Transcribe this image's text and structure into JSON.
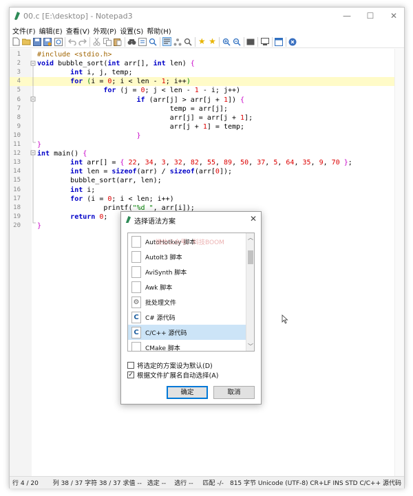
{
  "window": {
    "title": "00.c [E:\\desktop] - Notepad3",
    "controls": {
      "minimize": "—",
      "maximize": "☐",
      "close": "✕"
    }
  },
  "menu": [
    "文件(F)",
    "编辑(E)",
    "查看(V)",
    "外观(P)",
    "设置(S)",
    "帮助(H)"
  ],
  "toolbar": {
    "icons": [
      "new-file-icon",
      "open-folder-icon",
      "save-icon",
      "save-as-icon",
      "browse-icon",
      "undo-icon",
      "redo-icon",
      "cut-icon",
      "copy-icon",
      "paste-icon",
      "find-icon",
      "replace-icon",
      "goto-icon",
      "wordwrap-icon",
      "favorites-icon",
      "add-favorite-icon",
      "zoom-in-icon",
      "zoom-out-icon",
      "scheme-icon",
      "customize-icon",
      "open-window-icon",
      "settings-icon",
      "exit-icon"
    ]
  },
  "editor": {
    "active_line": 4,
    "lines": [
      {
        "n": "1",
        "html": "<span class=\"pp\">#include</span> <span class=\"pp\">&lt;stdio.h&gt;</span>"
      },
      {
        "n": "2",
        "html": "<span class=\"kw\">void</span> bubble_sort(<span class=\"kw\">int</span> arr[], <span class=\"kw\">int</span> len) <span class=\"brace\">{</span>"
      },
      {
        "n": "3",
        "html": "        <span class=\"kw\">int</span> i, j, temp;"
      },
      {
        "n": "4",
        "html": "        <span class=\"kw\">for</span> <span class=\"str\">(</span>i = <span class=\"num\">0</span>; i &lt; len - <span class=\"num\">1</span>; i++<span class=\"str\">)</span>"
      },
      {
        "n": "5",
        "html": "                <span class=\"kw\">for</span> (j = <span class=\"num\">0</span>; j &lt; len - <span class=\"num\">1</span> - i; j++)"
      },
      {
        "n": "6",
        "html": "                        <span class=\"kw\">if</span> (arr[j] &gt; arr[j + <span class=\"num\">1</span>]) <span class=\"brace\">{</span>"
      },
      {
        "n": "7",
        "html": "                                temp = arr[j];"
      },
      {
        "n": "8",
        "html": "                                arr[j] = arr[j + <span class=\"num\">1</span>];"
      },
      {
        "n": "9",
        "html": "                                arr[j + <span class=\"num\">1</span>] = temp;"
      },
      {
        "n": "10",
        "html": "                        <span class=\"brace\">}</span>"
      },
      {
        "n": "11",
        "html": "<span class=\"brace\">}</span>"
      },
      {
        "n": "12",
        "html": "<span class=\"kw\">int</span> main() <span class=\"brace\">{</span>"
      },
      {
        "n": "13",
        "html": "        <span class=\"kw\">int</span> arr[] = <span class=\"brace\">{</span> <span class=\"num\">22</span>, <span class=\"num\">34</span>, <span class=\"num\">3</span>, <span class=\"num\">32</span>, <span class=\"num\">82</span>, <span class=\"num\">55</span>, <span class=\"num\">89</span>, <span class=\"num\">50</span>, <span class=\"num\">37</span>, <span class=\"num\">5</span>, <span class=\"num\">64</span>, <span class=\"num\">35</span>, <span class=\"num\">9</span>, <span class=\"num\">70</span> <span class=\"brace\">}</span>;"
      },
      {
        "n": "14",
        "html": "        <span class=\"kw\">int</span> len = <span class=\"kw\">sizeof</span>(arr) / <span class=\"kw\">sizeof</span>(arr[<span class=\"num\">0</span>]);"
      },
      {
        "n": "15",
        "html": "        bubble_sort(arr, len);"
      },
      {
        "n": "16",
        "html": "        <span class=\"kw\">int</span> i;"
      },
      {
        "n": "17",
        "html": "        <span class=\"kw\">for</span> (i = <span class=\"num\">0</span>; i &lt; len; i++)"
      },
      {
        "n": "18",
        "html": "                printf(<span class=\"str\">\"%d \"</span>, arr[i]);"
      },
      {
        "n": "19",
        "html": "        <span class=\"kw\">return</span> <span class=\"num\">0</span>;"
      },
      {
        "n": "20",
        "html": "<span class=\"brace\">}</span>"
      }
    ]
  },
  "statusbar": {
    "line": "行 4 / 20",
    "col": "列 38 / 37 字符 38 / 37 求值 --",
    "sel": "选定 --",
    "sel_lines": "选行 --",
    "match": "匹配 -/-",
    "size": "815 字节 Unicode (UTF-8) CR+LF INS STD C/C++ 源代码"
  },
  "dialog": {
    "title": "选择语法方案",
    "watermark": "微信公众号：科技BOOM",
    "items": [
      {
        "label": "AutoHotkey 脚本",
        "icon": "file-icon",
        "selected": false
      },
      {
        "label": "AutoIt3 脚本",
        "icon": "file-icon",
        "selected": false
      },
      {
        "label": "AviSynth 脚本",
        "icon": "file-icon",
        "selected": false
      },
      {
        "label": "Awk 脚本",
        "icon": "file-icon",
        "selected": false
      },
      {
        "label": "批处理文件",
        "icon": "batch-gear-icon",
        "selected": false
      },
      {
        "label": "C# 源代码",
        "icon": "csharp-file-icon",
        "selected": false
      },
      {
        "label": "C/C++ 源代码",
        "icon": "c-file-icon",
        "selected": true
      },
      {
        "label": "CMake 脚本",
        "icon": "file-icon",
        "selected": false
      }
    ],
    "checkbox_default": {
      "label": "将选定的方案设为默认(D)",
      "checked": false
    },
    "checkbox_auto": {
      "label": "根据文件扩展名自动选择(A)",
      "checked": true
    },
    "ok_label": "确定",
    "cancel_label": "取消"
  }
}
